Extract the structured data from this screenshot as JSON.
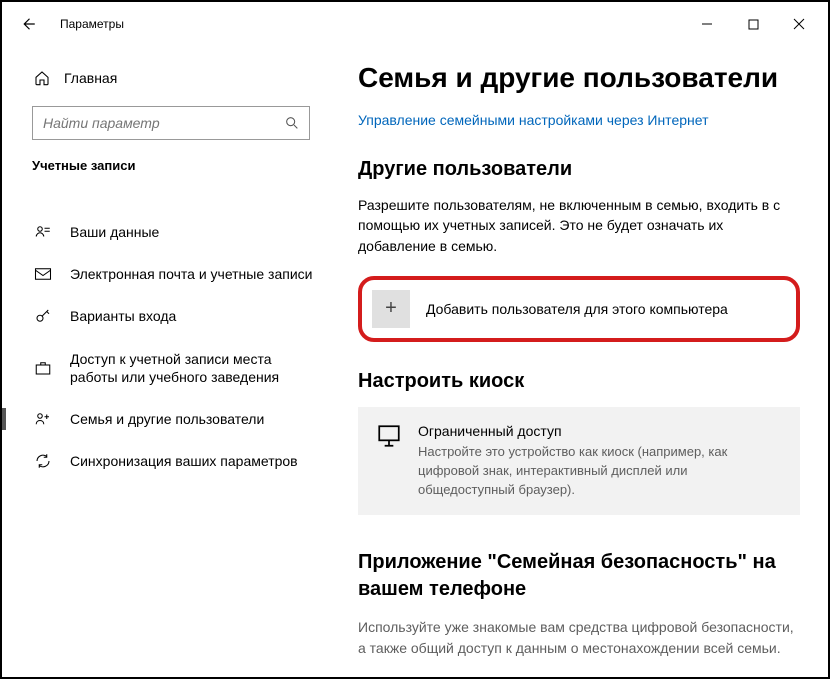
{
  "titlebar": {
    "title": "Параметры"
  },
  "sidebar": {
    "home": "Главная",
    "search_placeholder": "Найти параметр",
    "section": "Учетные записи",
    "items": [
      {
        "label": "Ваши данные"
      },
      {
        "label": "Электронная почта и учетные записи"
      },
      {
        "label": "Варианты входа"
      },
      {
        "label": "Доступ к учетной записи места работы или учебного заведения"
      },
      {
        "label": "Семья и другие пользователи"
      },
      {
        "label": "Синхронизация ваших параметров"
      }
    ]
  },
  "main": {
    "heading": "Семья и другие пользователи",
    "manage_link": "Управление семейными настройками через Интернет",
    "other_users_heading": "Другие пользователи",
    "other_users_desc": "Разрешите пользователям, не включенным в семью, входить в с помощью их учетных записей. Это не будет означать их добавление в семью.",
    "add_user_label": "Добавить пользователя для этого компьютера",
    "kiosk_heading": "Настроить киоск",
    "kiosk_card_title": "Ограниченный доступ",
    "kiosk_card_desc": "Настройте это устройство как киоск (например, как цифровой знак, интерактивный дисплей или общедоступный браузер).",
    "app_heading": "Приложение \"Семейная безопасность\" на вашем телефоне",
    "app_desc": "Используйте уже знакомые вам средства цифровой безопасности, а также общий доступ к данным о местонахождении всей семьи."
  }
}
